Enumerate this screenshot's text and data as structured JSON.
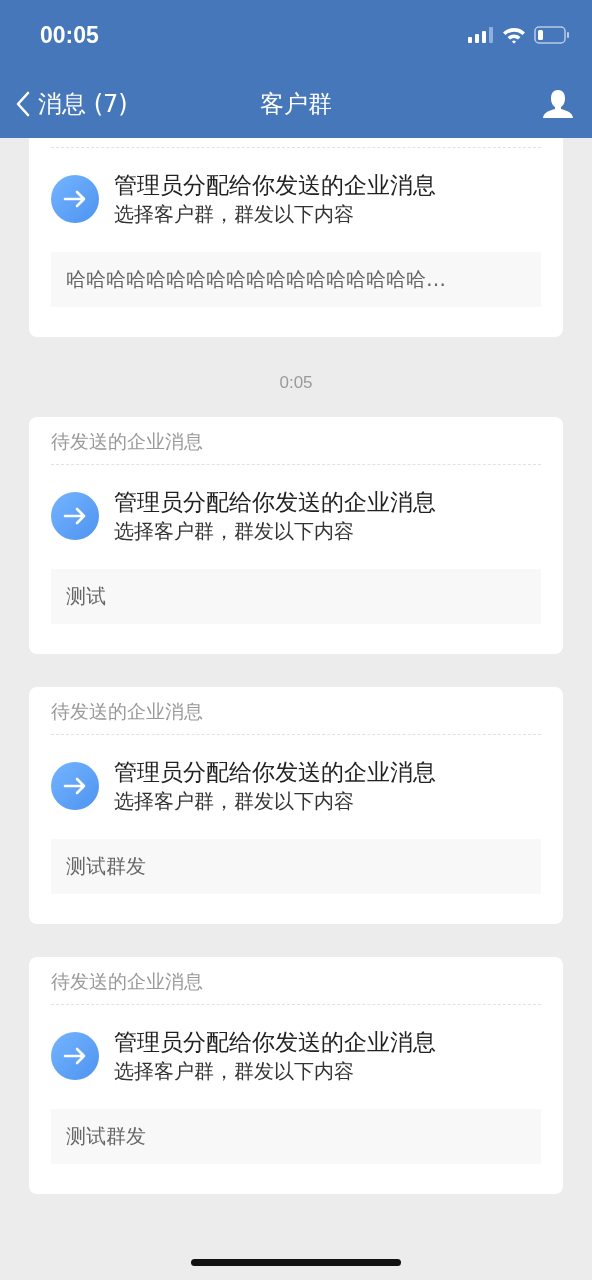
{
  "status_bar": {
    "time": "00:05"
  },
  "nav": {
    "back": "消息 (7)",
    "title": "客户群"
  },
  "items": [
    {
      "kind": "card",
      "title": "管理员分配给你发送的企业消息",
      "subtitle": "选择客户群，群发以下内容",
      "content": "哈哈哈哈哈哈哈哈哈哈哈哈哈哈哈哈哈哈…"
    },
    {
      "kind": "time",
      "text": "0:05"
    },
    {
      "kind": "card",
      "header": "待发送的企业消息",
      "title": "管理员分配给你发送的企业消息",
      "subtitle": "选择客户群，群发以下内容",
      "content": "测试"
    },
    {
      "kind": "card",
      "header": "待发送的企业消息",
      "title": "管理员分配给你发送的企业消息",
      "subtitle": "选择客户群，群发以下内容",
      "content": "测试群发"
    },
    {
      "kind": "card",
      "header": "待发送的企业消息",
      "title": "管理员分配给你发送的企业消息",
      "subtitle": "选择客户群，群发以下内容",
      "content": "测试群发"
    }
  ]
}
